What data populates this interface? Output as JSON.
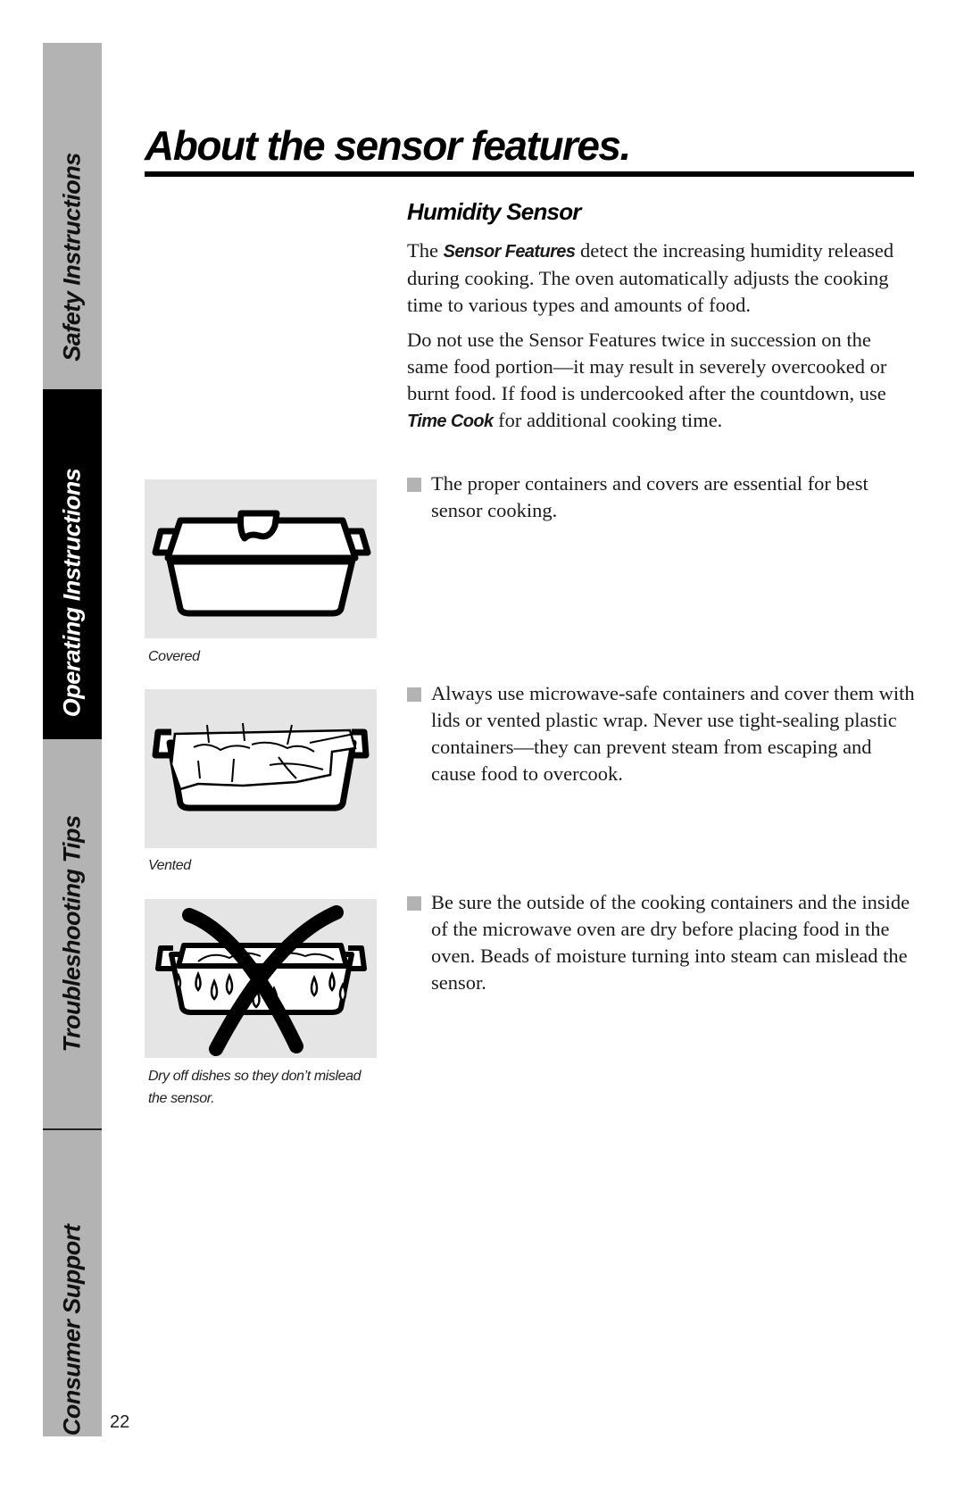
{
  "sidebar": {
    "tabs": [
      {
        "label": "Safety Instructions",
        "active": false
      },
      {
        "label": "Operating Instructions",
        "active": true
      },
      {
        "label": "Troubleshooting Tips",
        "active": false
      },
      {
        "label": "Consumer Support",
        "active": false
      }
    ]
  },
  "page": {
    "title": "About the sensor features.",
    "number": "22"
  },
  "section": {
    "heading": "Humidity Sensor",
    "paragraph1": {
      "prefix": "The ",
      "emphasis": "Sensor Features",
      "suffix": " detect the increasing humidity released during cooking. The oven automatically adjusts the cooking time to various types and amounts of food."
    },
    "paragraph2": {
      "prefix": "Do not use the Sensor Features twice in succession on the same food portion—it may result in severely overcooked or burnt food. If food is undercooked after the countdown, use ",
      "emphasis": "Time Cook",
      "suffix": " for additional cooking time."
    },
    "bullets": [
      "The proper containers and covers are essential for best sensor cooking.",
      "Always use microwave-safe containers and cover them with lids or vented plastic wrap. Never use tight-sealing plastic containers—they can prevent steam from escaping and cause food to overcook.",
      "Be sure the outside of the cooking containers and the inside of the microwave oven are dry before placing food in the oven. Beads of moisture turning into steam can mislead the sensor."
    ]
  },
  "figures": [
    {
      "icon": "covered-dish-icon",
      "caption": "Covered"
    },
    {
      "icon": "vented-dish-icon",
      "caption": "Vented"
    },
    {
      "icon": "wet-dish-crossed-icon",
      "caption": "Dry off dishes so they don’t mislead the sensor."
    }
  ],
  "colors": {
    "tab_inactive": "#b3b3b3",
    "tab_active": "#000000",
    "figure_bg": "#e5e5e5",
    "bullet_marker": "#b3b3b3"
  }
}
